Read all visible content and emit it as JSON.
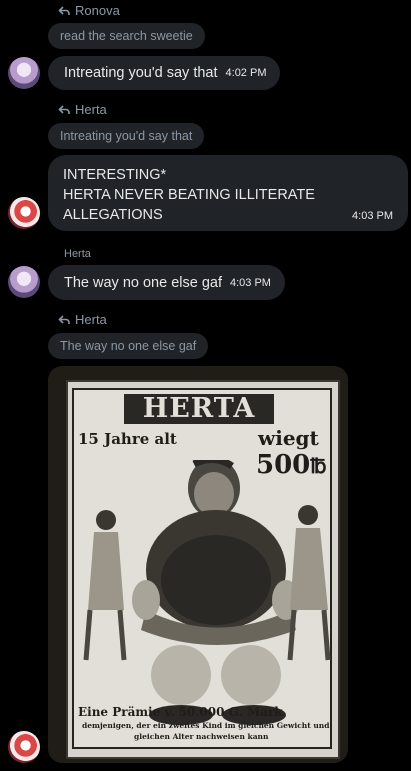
{
  "messages": [
    {
      "reply_to": "Ronova",
      "quoted": "read the search sweetie",
      "text": "Intreating you'd say that",
      "time": "4:02 PM"
    },
    {
      "reply_to": "Herta",
      "quoted": "Intreating you'd say that",
      "lines": [
        "INTERESTING*",
        "HERTA NEVER BEATING ILLITERATE",
        "ALLEGATIONS"
      ],
      "time": "4:03 PM"
    },
    {
      "sender": "Herta",
      "text": "The way no one else gaf",
      "time": "4:03 PM"
    },
    {
      "reply_to": "Herta",
      "quoted": "The way no one else gaf"
    }
  ],
  "poster": {
    "title": "HERTA",
    "left": "15 Jahre alt",
    "right": "wiegt",
    "weight": "500",
    "unit": "℔",
    "prize": "Eine Prämie v. 50.000 G. Mark",
    "line1": "demjenigen, der ein zweites Kind im gleichen Gewicht und",
    "line2": "gleichen Alter nachweisen kann"
  },
  "icons": {
    "reply": "reply-arrow-icon"
  }
}
